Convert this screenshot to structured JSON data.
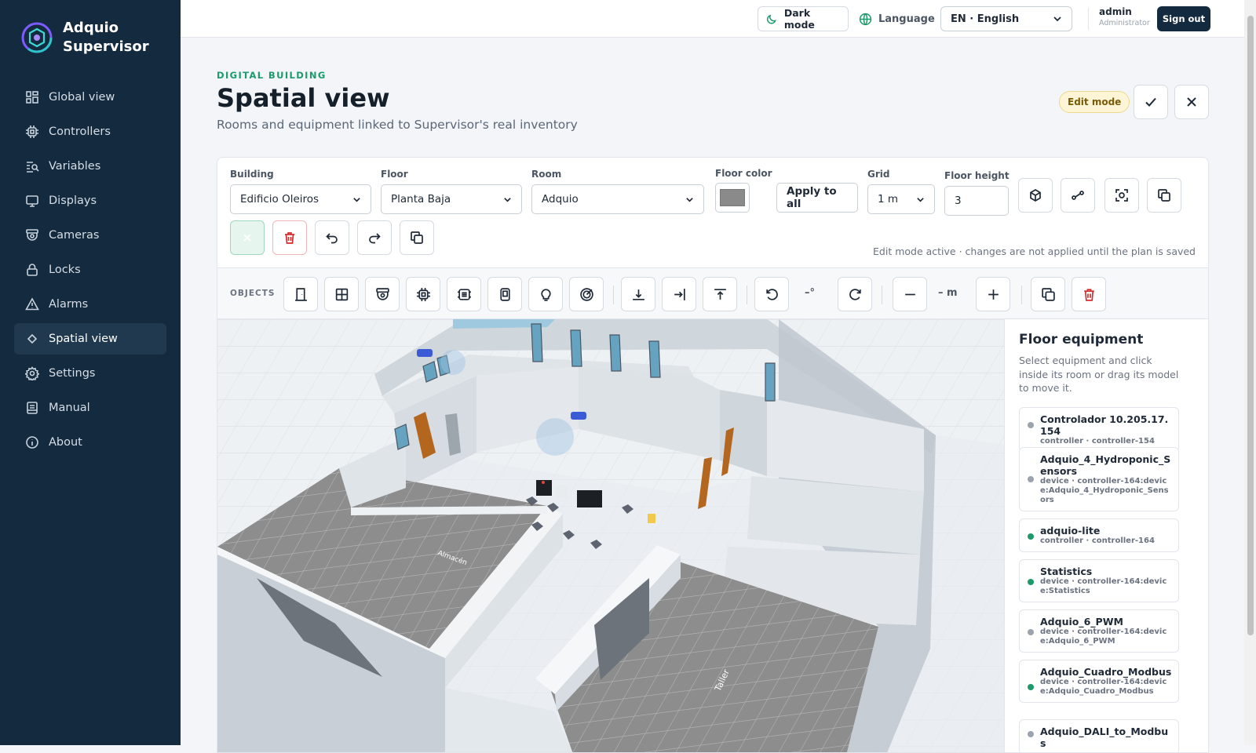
{
  "app": {
    "name_line1": "Adquio",
    "name_line2": "Supervisor"
  },
  "sidebar": {
    "items": [
      {
        "label": "Global view",
        "icon": "grid-icon"
      },
      {
        "label": "Controllers",
        "icon": "chip-icon"
      },
      {
        "label": "Variables",
        "icon": "list-search-icon"
      },
      {
        "label": "Displays",
        "icon": "monitor-icon"
      },
      {
        "label": "Cameras",
        "icon": "camera-icon"
      },
      {
        "label": "Locks",
        "icon": "lock-icon"
      },
      {
        "label": "Alarms",
        "icon": "warning-icon"
      },
      {
        "label": "Spatial view",
        "icon": "diamond-icon",
        "active": true
      },
      {
        "label": "Settings",
        "icon": "gear-icon"
      },
      {
        "label": "Manual",
        "icon": "book-icon"
      },
      {
        "label": "About",
        "icon": "info-icon"
      }
    ]
  },
  "topbar": {
    "dark_mode": "Dark mode",
    "language_label": "Language",
    "language_value": "EN · English",
    "user_name": "admin",
    "user_role": "Administrator",
    "sign_out": "Sign out"
  },
  "header": {
    "eyebrow": "DIGITAL BUILDING",
    "title": "Spatial view",
    "subtitle": "Rooms and equipment linked to Supervisor's real inventory",
    "edit_badge": "Edit mode"
  },
  "controls": {
    "building_label": "Building",
    "building_value": "Edificio Oleiros",
    "floor_label": "Floor",
    "floor_value": "Planta Baja",
    "room_label": "Room",
    "room_value": "Adquio",
    "floor_color_label": "Floor color",
    "floor_color": "#8a8a8a",
    "apply_all": "Apply to all",
    "grid_label": "Grid",
    "grid_value": "1 m",
    "floor_height_label": "Floor height",
    "floor_height_value": "3",
    "hint": "Edit mode active · changes are not applied until the plan is saved"
  },
  "objects": {
    "label": "OBJECTS",
    "rotation_value": "–°",
    "size_value": "– m"
  },
  "scene": {
    "room_labels": [
      "Almacén",
      "Taller"
    ]
  },
  "equipment": {
    "title": "Floor equipment",
    "description": "Select equipment and click inside its room or drag its model to move it.",
    "items": [
      {
        "name": "Controlador 10.205.17.154",
        "meta": "controller · controller-154",
        "status": "#9aa3ae"
      },
      {
        "name": "Adquio_4_Hydroponic_Sensors",
        "meta": "device · controller-164:device:Adquio_4_Hydroponic_Sensors",
        "status": "#9aa3ae"
      },
      {
        "name": "adquio-lite",
        "meta": "controller · controller-164",
        "status": "#1c9a6c"
      },
      {
        "name": "Statistics",
        "meta": "device · controller-164:device:Statistics",
        "status": "#1c9a6c"
      },
      {
        "name": "Adquio_6_PWM",
        "meta": "device · controller-164:device:Adquio_6_PWM",
        "status": "#9aa3ae"
      },
      {
        "name": "Adquio_Cuadro_Modbus",
        "meta": "device · controller-164:device:Adquio_Cuadro_Modbus",
        "status": "#1c9a6c"
      },
      {
        "name": "Adquio_DALI_to_Modbus",
        "meta": "",
        "status": "#9aa3ae"
      }
    ]
  }
}
